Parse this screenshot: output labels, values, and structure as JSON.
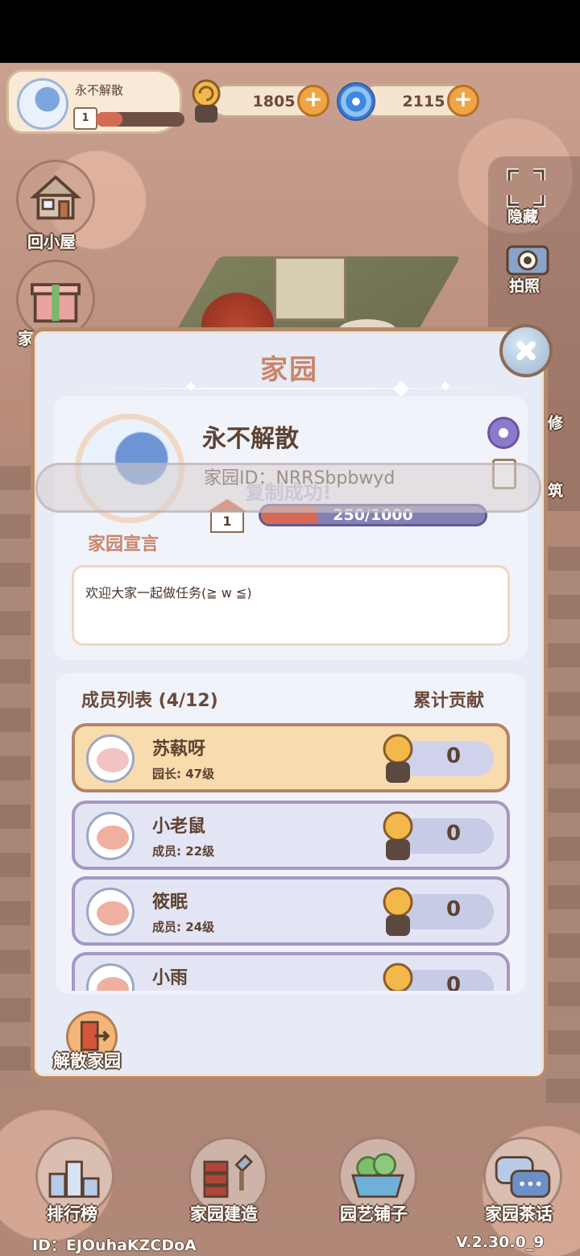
{
  "top_hud": {
    "home_name": "永不解散",
    "home_level": "1",
    "level_progress": 0.3,
    "snail_currency": "1805",
    "swirl_currency": "2115"
  },
  "side_menu": {
    "back_home_label": "回小屋",
    "gift_label_partial": "家",
    "hide_label": "隐藏",
    "photo_label": "拍照",
    "repair_label_partial": "修",
    "build_label_partial": "筑"
  },
  "modal": {
    "title": "家园",
    "home_name": "永不解散",
    "home_id": "家园ID：NRRSbpbwyd",
    "level": "1",
    "exp_text": "250/1000",
    "exp_fraction": 0.25,
    "declaration_label": "家园宣言",
    "declaration_text": "欢迎大家一起做任务(≧ w ≦)",
    "toast": "复制成功!",
    "members_title": "成员列表 (4/12)",
    "contribution_title": "累计贡献",
    "members": [
      {
        "name": "苏蓻呀",
        "role": "园长: 47级",
        "score": "0",
        "avatar": "bunny-avatar"
      },
      {
        "name": "小老鼠",
        "role": "成员: 22级",
        "score": "0",
        "avatar": "snail-avatar"
      },
      {
        "name": "筱眠",
        "role": "成员: 24级",
        "score": "0",
        "avatar": "snail-avatar"
      },
      {
        "name": "小雨",
        "role": "",
        "score": "0",
        "avatar": "snail-avatar"
      }
    ],
    "dissolve_label": "解散家园"
  },
  "bottom_nav": {
    "rank_label": "排行榜",
    "build_label": "家园建造",
    "shop_label": "园艺铺子",
    "chat_label": "家园茶话"
  },
  "footer": {
    "user_id": "ID：EJOuhaKZCDoA",
    "version": "V.2.30.0_9"
  },
  "colors": {
    "accent": "#c8866a",
    "modal_bg": "#e6ebf5",
    "frame": "#b48a6e",
    "exp_fill": "#d76a56"
  }
}
